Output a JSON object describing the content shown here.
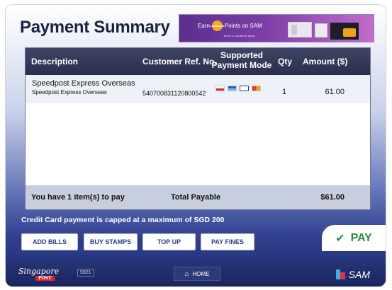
{
  "page": {
    "title": "Payment Summary"
  },
  "banner": {
    "earn_text_before": "Earn",
    "coin_label": "Linkpoints",
    "earn_text_after": "Points on SAM",
    "sub_text": "Terms & conditions apply"
  },
  "table": {
    "headers": {
      "description": "Description",
      "customer_ref": "Customer Ref. No.",
      "payment_mode_line1": "Supported",
      "payment_mode_line2": "Payment Mode",
      "qty": "Qty",
      "amount": "Amount ($)"
    },
    "rows": [
      {
        "description": "Speedpost Express Overseas",
        "sub_description": "Speedpost Express Overseas",
        "customer_ref": "540700831120800542",
        "payment_modes": [
          "nets-icon",
          "cashcard-icon",
          "visa-icon",
          "mastercard-icon"
        ],
        "qty": "1",
        "amount": "61.00"
      }
    ],
    "footer": {
      "items_text": "You have 1 item(s) to pay",
      "total_label": "Total Payable",
      "total_value": "$61.00"
    }
  },
  "notice": "Credit Card payment is capped at a maximum of SGD 200",
  "buttons": {
    "add_bills": "ADD BILLS",
    "buy_stamps": "BUY STAMPS",
    "top_up": "TOP UP",
    "pay_fines": "PAY FINES",
    "pay": "PAY"
  },
  "footer": {
    "logo_text": "Singapore",
    "logo_post": "POST",
    "kiosk_id": "5921",
    "home_label": "HOME",
    "brand": "SAM"
  },
  "colors": {
    "header_bg": "#2a2f4a",
    "pay_green": "#2c8a44",
    "button_text": "#2b3a8a",
    "footer_bg": "#1b2660"
  }
}
